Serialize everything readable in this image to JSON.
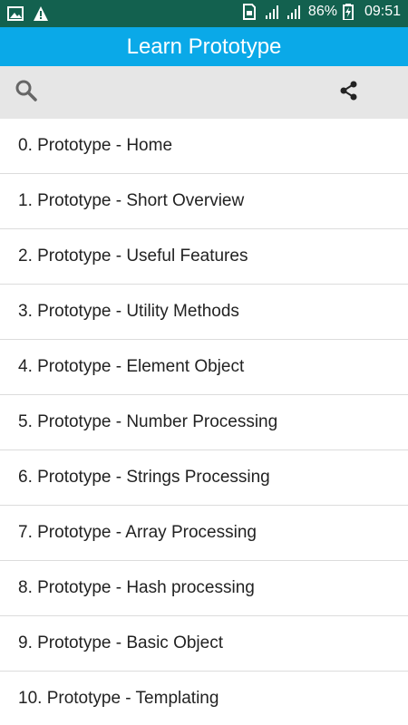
{
  "status_bar": {
    "battery": "86%",
    "time": "09:51",
    "icons": [
      "image-icon",
      "warning-icon",
      "sim-icon",
      "signal-icon",
      "signal-icon",
      "battery-icon"
    ]
  },
  "app": {
    "title": "Learn Prototype"
  },
  "toolbar": {
    "search_icon": "search-icon",
    "share_icon": "share-icon"
  },
  "list": {
    "items": [
      "0. Prototype - Home",
      "1. Prototype - Short Overview",
      "2. Prototype - Useful Features",
      "3. Prototype - Utility Methods",
      "4. Prototype - Element Object",
      "5. Prototype - Number Processing",
      "6. Prototype - Strings Processing",
      "7. Prototype - Array Processing",
      "8. Prototype - Hash processing",
      "9. Prototype - Basic Object",
      "10. Prototype - Templating"
    ]
  },
  "colors": {
    "status_bar": "#13614f",
    "title_bar": "#0aa9e8",
    "toolbar": "#e6e6e6"
  }
}
